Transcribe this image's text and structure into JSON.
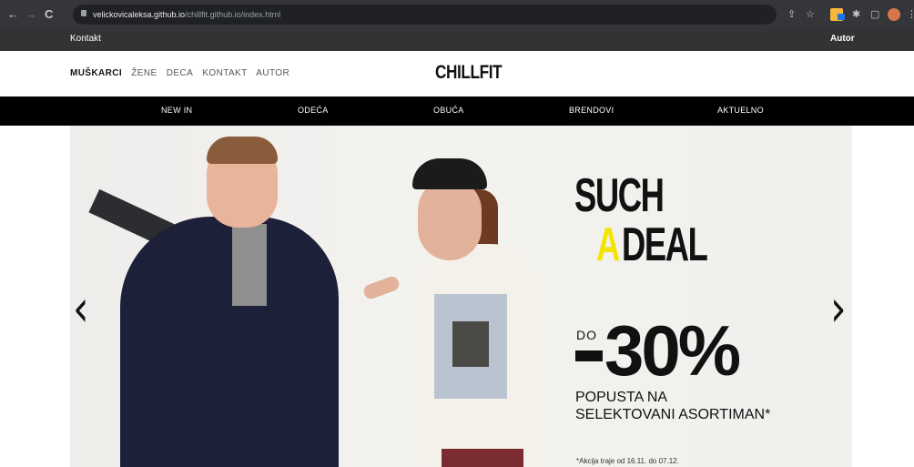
{
  "browser": {
    "url_domain": "velickovicaleksa.github.io",
    "url_path": "/chillfit.github.io/index.html",
    "back": "←",
    "forward": "→",
    "reload": "C",
    "share_icon": "⇪",
    "star_icon": "☆",
    "puzzle_icon": "✱",
    "sidebar_icon": "▢",
    "menu_icon": "⋮"
  },
  "topbar": {
    "left_link": "Kontakt",
    "right_link": "Autor"
  },
  "header": {
    "categories": [
      "MUŠKARCI",
      "ŽENE",
      "DECA",
      "KONTAKT",
      "AUTOR"
    ],
    "logo": "CHILLFIT"
  },
  "menu": {
    "items": [
      "NEW IN",
      "ODEĆA",
      "OBUĆA",
      "BRENDOVI",
      "AKTUELNO"
    ]
  },
  "hero": {
    "prev_arrow": "‹",
    "next_arrow": "›",
    "headline_top": "SUCH",
    "headline_a": "A",
    "headline_bottom": "DEAL",
    "do_label": "DO",
    "discount": "30%",
    "subtitle_line1": "POPUSTA NA",
    "subtitle_line2": "SELEKTOVANI ASORTIMAN*",
    "footnote": "*Akcija traje od 16.11. do 07.12.",
    "accent_color": "#f3e500"
  }
}
